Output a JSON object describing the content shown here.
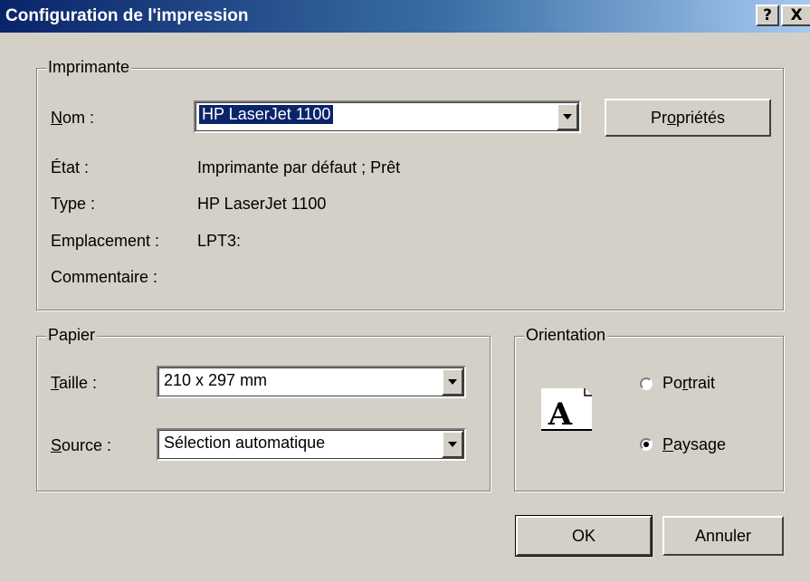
{
  "window": {
    "title": "Configuration de l'impression",
    "help_label": "?",
    "close_label": "X"
  },
  "printer_group": {
    "legend": "Imprimante",
    "name_label_accel": "N",
    "name_label_rest": "om :",
    "name_value": "HP LaserJet 1100",
    "properties_pre": "Pr",
    "properties_accel": "o",
    "properties_post": "priétés",
    "state_label": "État :",
    "state_value": "Imprimante par défaut ; Prêt",
    "type_label": "Type :",
    "type_value": "HP LaserJet 1100",
    "location_label": "Emplacement :",
    "location_value": "LPT3:",
    "comment_label": "Commentaire :"
  },
  "paper_group": {
    "legend": "Papier",
    "size_label_accel": "T",
    "size_label_rest": "aille :",
    "size_value": "210 x 297 mm",
    "source_label_accel": "S",
    "source_label_rest": "ource :",
    "source_value": "Sélection automatique"
  },
  "orientation_group": {
    "legend": "Orientation",
    "icon": "landscape-page-icon",
    "portrait_pre": "Po",
    "portrait_accel": "r",
    "portrait_post": "trait",
    "landscape_accel": "P",
    "landscape_rest": "aysage",
    "selected": "Paysage"
  },
  "buttons": {
    "ok_label": "OK",
    "cancel_label": "Annuler"
  },
  "colors": {
    "dialog_bg": "#d4d0c8",
    "title_start": "#0a246a",
    "title_end": "#a6caf0",
    "selection": "#0a246a"
  }
}
